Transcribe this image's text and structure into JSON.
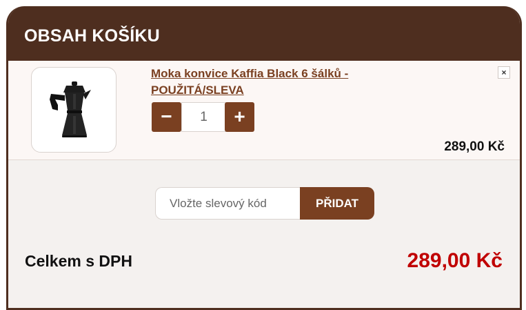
{
  "cart": {
    "title": "OBSAH KOŠÍKU",
    "item": {
      "name": "Moka konvice Kaffia Black 6 šálků - POUŽITÁ/SLEVA",
      "quantity": "1",
      "minus_label": "−",
      "plus_label": "+",
      "remove_label": "×",
      "price": "289,00 Kč",
      "image_icon": "moka-pot-icon"
    },
    "coupon": {
      "placeholder": "Vložte slevový kód",
      "button_label": "PŘIDAT"
    },
    "total": {
      "label": "Celkem s DPH",
      "value": "289,00 Kč"
    },
    "colors": {
      "header": "#4e2e1f",
      "accent": "#7a4021",
      "total_value": "#c00000"
    }
  }
}
